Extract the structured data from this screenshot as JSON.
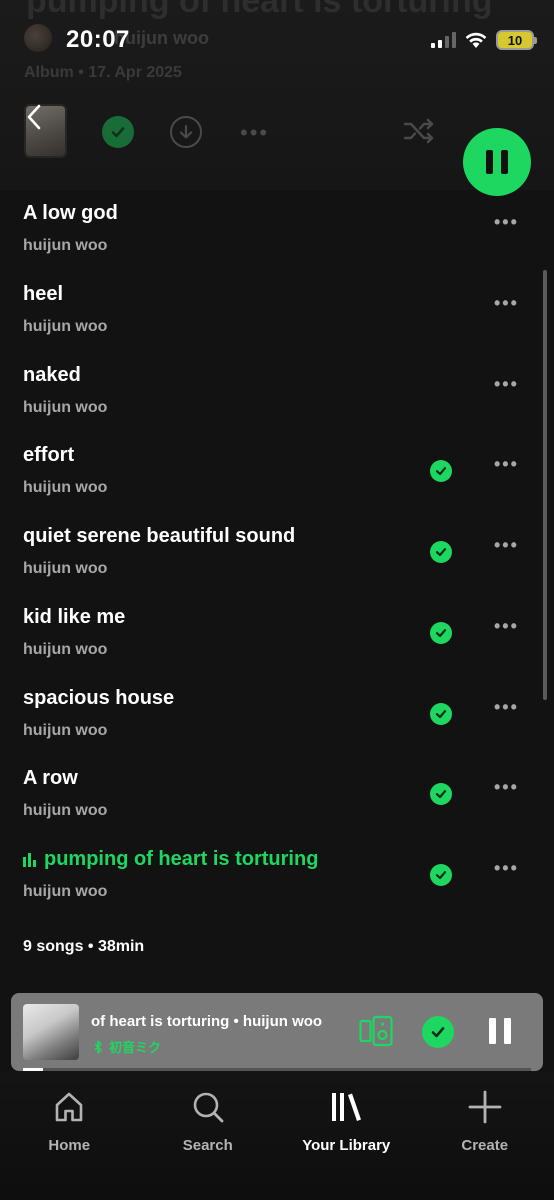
{
  "header": {
    "faded_title": "pumping of heart is torturing",
    "faded_artist": "huijun woo",
    "faded_meta": "Album • 17. Apr 2025"
  },
  "status_bar": {
    "time": "20:07",
    "battery": "10"
  },
  "tracks": [
    {
      "title": "A low god",
      "artist": "huijun woo",
      "saved": false,
      "playing": false
    },
    {
      "title": "heel",
      "artist": "huijun woo",
      "saved": false,
      "playing": false
    },
    {
      "title": "naked",
      "artist": "huijun woo",
      "saved": false,
      "playing": false
    },
    {
      "title": "effort",
      "artist": "huijun woo",
      "saved": true,
      "playing": false
    },
    {
      "title": "quiet serene beautiful sound",
      "artist": "huijun woo",
      "saved": true,
      "playing": false
    },
    {
      "title": "kid like me",
      "artist": "huijun woo",
      "saved": true,
      "playing": false
    },
    {
      "title": "spacious house",
      "artist": "huijun woo",
      "saved": true,
      "playing": false
    },
    {
      "title": "A row",
      "artist": "huijun woo",
      "saved": true,
      "playing": false
    },
    {
      "title": "pumping of heart is torturing",
      "artist": "huijun woo",
      "saved": true,
      "playing": true
    }
  ],
  "summary": "9 songs • 38min",
  "mini_player": {
    "title": "of heart is torturing • huijun woo",
    "device": "初音ミク",
    "progress": 0.04
  },
  "nav": [
    {
      "label": "Home",
      "icon": "home-icon",
      "active": false
    },
    {
      "label": "Search",
      "icon": "search-icon",
      "active": false
    },
    {
      "label": "Your Library",
      "icon": "library-icon",
      "active": true
    },
    {
      "label": "Create",
      "icon": "plus-icon",
      "active": false
    }
  ],
  "colors": {
    "accent": "#1ed760",
    "background": "#121212",
    "mini_player": "#7a7a7a"
  }
}
